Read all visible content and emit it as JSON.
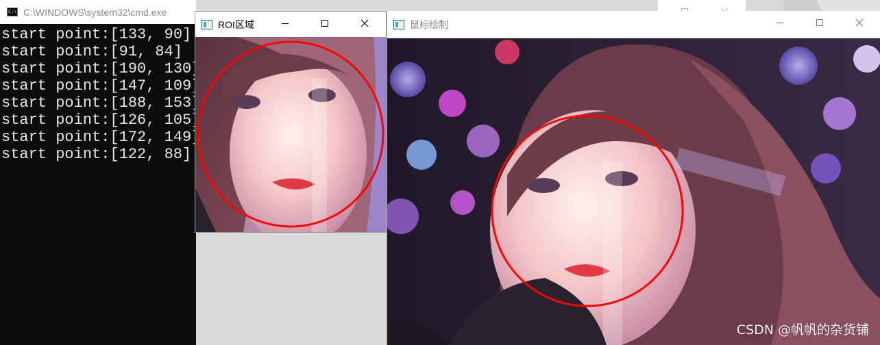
{
  "console": {
    "title": "C:\\WINDOWS\\system32\\cmd.exe",
    "icon": "cmd-icon",
    "lines": [
      "start point:[133, 90]",
      "start point:[91, 84]",
      "start point:[190, 130]",
      "start point:[147, 109]",
      "start point:[188, 153]",
      "start point:[126, 105]",
      "start point:[172, 149]",
      "start point:[122, 88]"
    ]
  },
  "roi_window": {
    "title": "ROI区域",
    "icon": "opencv-window-icon"
  },
  "draw_window": {
    "title": "鼠标绘制",
    "icon": "opencv-window-icon"
  },
  "watermark": "CSDN @帆帆的杂货铺",
  "colors": {
    "circle": "#ff0000",
    "console_bg": "#0c0c0c",
    "console_text": "#e6e6e6"
  }
}
